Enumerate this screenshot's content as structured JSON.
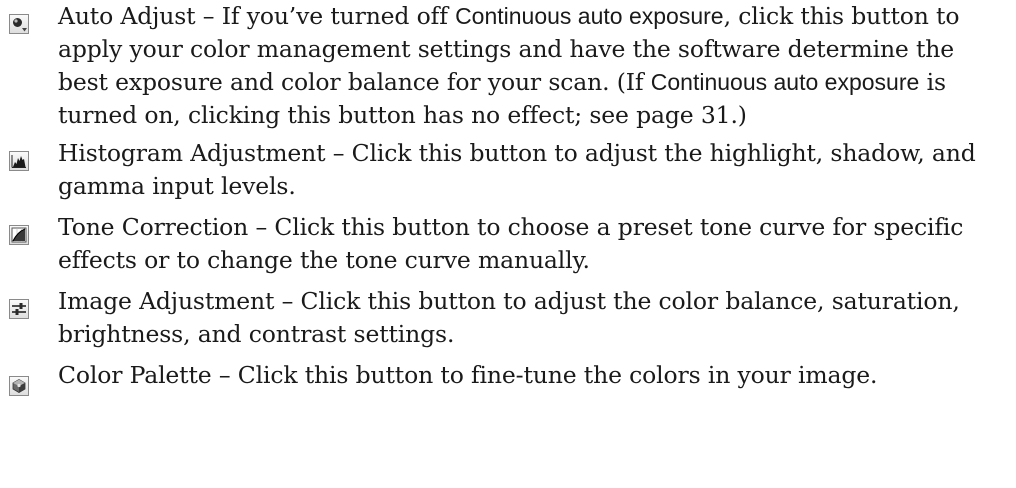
{
  "items": [
    {
      "icon": "auto-adjust-icon",
      "text_before": "Auto Adjust – If you’ve turned off ",
      "em1": "Continuous auto exposure",
      "text_mid": ", click this button to apply your color management settings and have the software determine the best exposure and color balance for your scan. (If ",
      "em2": "Continuous auto exposure",
      "text_after": " is turned on, clicking this button has no effect; see page 31.)"
    },
    {
      "icon": "histogram-icon",
      "text": "Histogram Adjustment – Click this button to adjust the highlight, shadow, and gamma input levels."
    },
    {
      "icon": "tone-curve-icon",
      "text": "Tone Correction – Click this button to choose a preset tone curve for specific effects or to change the tone curve manually."
    },
    {
      "icon": "image-adjustment-icon",
      "text": "Image Adjustment – Click this button to adjust the color balance, saturation, brightness, and contrast settings."
    },
    {
      "icon": "color-palette-icon",
      "text": "Color Palette – Click this button to fine-tune the colors in your image."
    }
  ]
}
